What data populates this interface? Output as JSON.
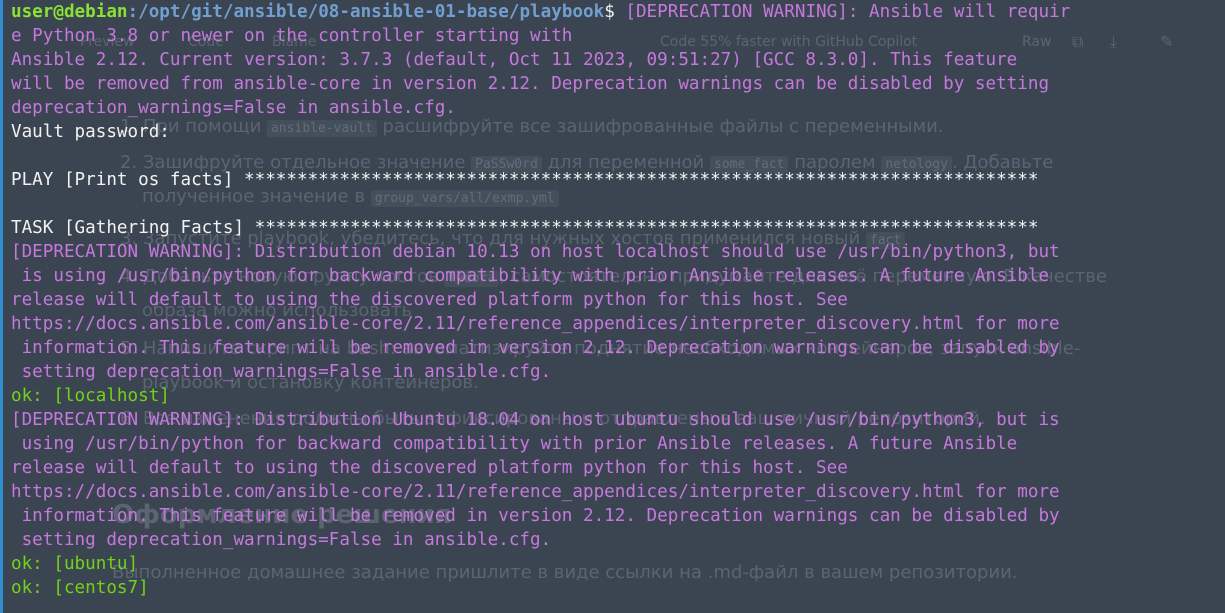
{
  "background_page": {
    "tabs": [
      "Preview",
      "Code",
      "Blame"
    ],
    "copilot_banner": "Code 55% faster with GitHub Copilot",
    "raw_button": "Raw",
    "lines": [
      "1. При помощи",
      "ansible-vault",
      "расшифруйте все зашифрованные файлы с переменными.",
      "2. Зашифруйте отдельное значение",
      "PaSSw0rd",
      "для переменной",
      "some_fact",
      "паролем",
      "netology",
      ". Добавьте",
      "полученное значение в",
      "group_vars/all/exmp.yml",
      "3. Запустите playbook, убедитесь, что для нужных хостов применился новый",
      "fact",
      "4. Добавьте новую группу хостов",
      "fedora",
      ", самостоятельно придумайте для неё переменную. В качестве",
      "образа можно использовать",
      "5. Напишите скрипт на bash: автоматизируйте поднятие необходимых контейнеров, запуск ansible-",
      "playbook и остановку контейнеров.",
      "6. Все изменения должны быть зафиксированы и отправлены в ваш личный репозиторий.",
      "Оформление решения",
      "Выполненное домашнее задание пришлите в виде ссылки на .md-файл в вашем репозитории."
    ]
  },
  "terminal": {
    "prompt_user": "user@debian",
    "prompt_path": ":/opt/git/ansible/08-ansible-01-base/playbook",
    "prompt_symbol": "$ ",
    "lines": [
      {
        "style": "warn",
        "text": "[DEPRECATION WARNING]: Ansible will requir"
      },
      {
        "style": "warn",
        "text": "e Python 3.8 or newer on the controller starting with"
      },
      {
        "style": "warn",
        "text": "Ansible 2.12. Current version: 3.7.3 (default, Oct 11 2023, 09:51:27) [GCC 8.3.0]. This feature"
      },
      {
        "style": "warn",
        "text": "will be removed from ansible-core in version 2.12. Deprecation warnings can be disabled by setting"
      },
      {
        "style": "warn",
        "text": "deprecation_warnings=False in ansible.cfg."
      },
      {
        "style": "white",
        "text": "Vault password:"
      },
      {
        "style": "white",
        "text": ""
      },
      {
        "style": "white",
        "text": "PLAY [Print os facts] ***************************************************************************"
      },
      {
        "style": "white",
        "text": ""
      },
      {
        "style": "white",
        "text": "TASK [Gathering Facts] **************************************************************************"
      },
      {
        "style": "warn",
        "text": "[DEPRECATION WARNING]: Distribution debian 10.13 on host localhost should use /usr/bin/python3, but"
      },
      {
        "style": "warn",
        "text": " is using /usr/bin/python for backward compatibility with prior Ansible releases. A future Ansible"
      },
      {
        "style": "warn",
        "text": "release will default to using the discovered platform python for this host. See"
      },
      {
        "style": "warn",
        "text": "https://docs.ansible.com/ansible-core/2.11/reference_appendices/interpreter_discovery.html for more"
      },
      {
        "style": "warn",
        "text": " information. This feature will be removed in version 2.12. Deprecation warnings can be disabled by"
      },
      {
        "style": "warn",
        "text": " setting deprecation_warnings=False in ansible.cfg."
      },
      {
        "style": "ok",
        "text": "ok: [localhost]"
      },
      {
        "style": "warn",
        "text": "[DEPRECATION WARNING]: Distribution Ubuntu 18.04 on host ubuntu should use /usr/bin/python3, but is"
      },
      {
        "style": "warn",
        "text": " using /usr/bin/python for backward compatibility with prior Ansible releases. A future Ansible"
      },
      {
        "style": "warn",
        "text": "release will default to using the discovered platform python for this host. See"
      },
      {
        "style": "warn",
        "text": "https://docs.ansible.com/ansible-core/2.11/reference_appendices/interpreter_discovery.html for more"
      },
      {
        "style": "warn",
        "text": " information. This feature will be removed in version 2.12. Deprecation warnings can be disabled by"
      },
      {
        "style": "warn",
        "text": " setting deprecation_warnings=False in ansible.cfg."
      },
      {
        "style": "ok",
        "text": "ok: [ubuntu]"
      },
      {
        "style": "ok",
        "text": "ok: [centos7]"
      }
    ]
  },
  "colors": {
    "background": "#3a4551",
    "user": "#8ae234",
    "path": "#729fcf",
    "text": "#f2f2f2",
    "warning": "#c678dd",
    "ok": "#73d216",
    "window_edge": "#2f8fd0"
  }
}
